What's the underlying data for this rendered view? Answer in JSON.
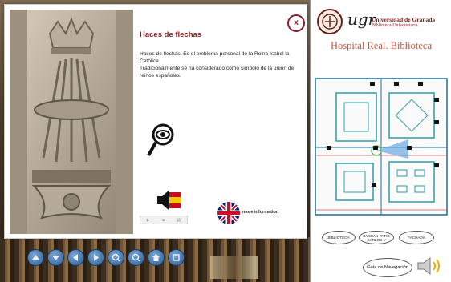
{
  "popup": {
    "title": "Haces de flechas",
    "description_1": "Haces de flechas. Es el emblema personal de la Reina Isabel la Católica.",
    "description_2": "Tradicionalmente se ha considerado como símbolo de la unión de reinos españoles.",
    "close_label": "x",
    "more_info_label": "more information"
  },
  "header": {
    "logo_text": "ugr",
    "university": "Universidad de Granada",
    "library": "Biblioteca Universitaria",
    "place_title": "Hospital Real. Biblioteca"
  },
  "locations": [
    {
      "label": "BIBLIOTECA"
    },
    {
      "label": "ZAGUÁN PATIO CARLOS V"
    },
    {
      "label": "FACHADA"
    }
  ],
  "guide_label": "Guía de Navegación",
  "nav_buttons": [
    "arrow-up-icon",
    "arrow-down-icon",
    "arrow-left-icon",
    "arrow-right-icon",
    "zoom-in-icon",
    "zoom-out-icon",
    "home-icon",
    "fullscreen-icon"
  ],
  "colors": {
    "accent": "#8b1a1a",
    "nav": "#2d5b8f",
    "place_title": "#c0553e"
  }
}
